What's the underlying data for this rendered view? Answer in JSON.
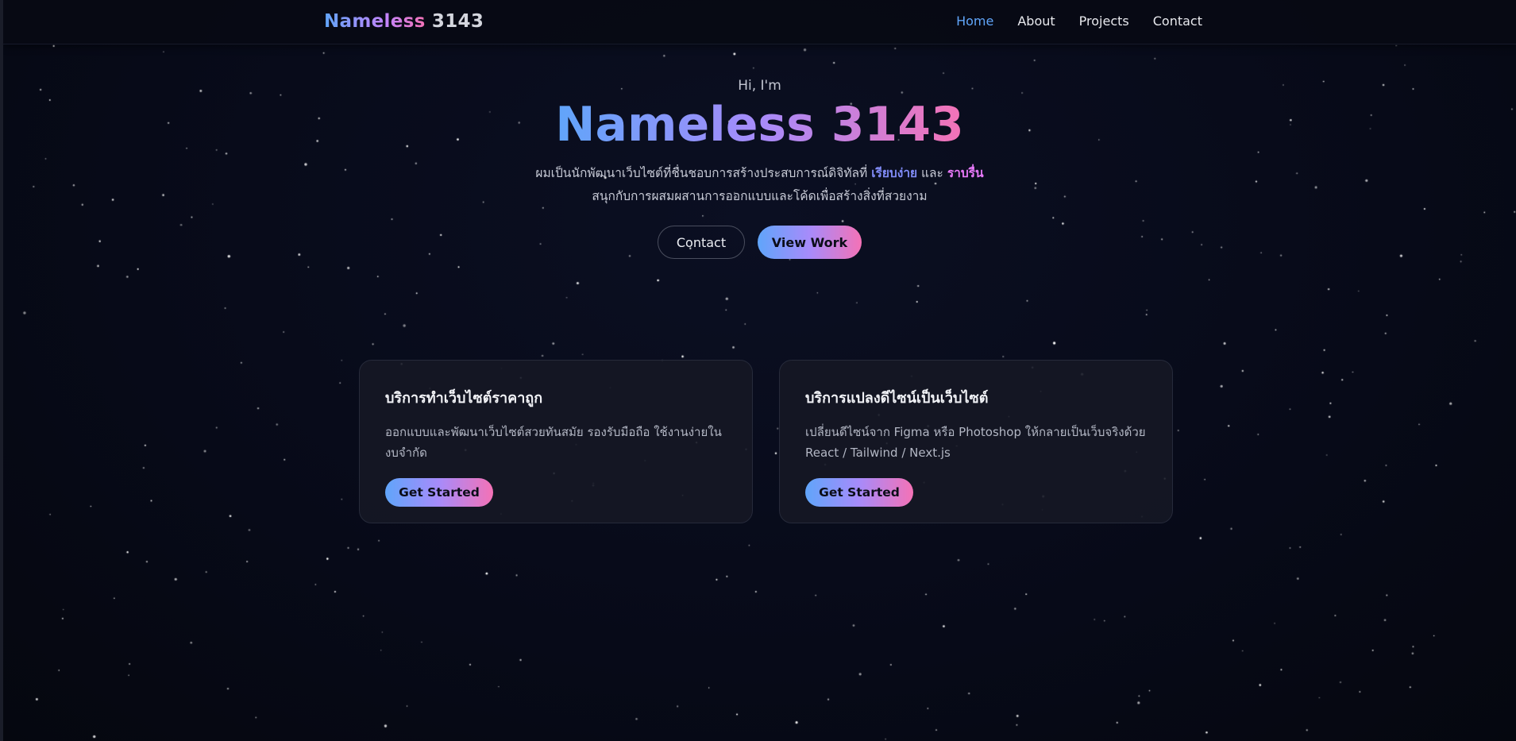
{
  "nav": {
    "brand_name": "Nameless",
    "brand_number": "3143",
    "links": [
      {
        "label": "Home",
        "active": true
      },
      {
        "label": "About",
        "active": false
      },
      {
        "label": "Projects",
        "active": false
      },
      {
        "label": "Contact",
        "active": false
      }
    ]
  },
  "hero": {
    "greeting": "Hi, I'm",
    "title": "Nameless 3143",
    "line1_prefix": "ผมเป็นนักพัฒนาเว็บไซต์ที่ชื่นชอบการสร้างประสบการณ์ดิจิทัลที่",
    "line1_accent1": "เรียบง่าย",
    "line1_middle": "และ",
    "line1_accent2": "ราบรื่น",
    "line2": "สนุกกับการผสมผสานการออกแบบและโค้ดเพื่อสร้างสิ่งที่สวยงาม",
    "contact_button": "Contact",
    "view_work_button": "View Work"
  },
  "services": [
    {
      "title": "บริการทำเว็บไซต์ราคาถูก",
      "description": "ออกแบบและพัฒนาเว็บไซต์สวยทันสมัย รองรับมือถือ ใช้งานง่ายในงบจำกัด",
      "button": "Get Started"
    },
    {
      "title": "บริการแปลงดีไซน์เป็นเว็บไซต์",
      "description": "เปลี่ยนดีไซน์จาก Figma หรือ Photoshop ให้กลายเป็นเว็บจริงด้วย React / Tailwind / Next.js",
      "button": "Get Started"
    }
  ],
  "colors": {
    "background": "#070a18",
    "nav_active": "#60a5fa",
    "gradient_start": "#60a5fa",
    "gradient_mid": "#a78bfa",
    "gradient_end": "#f472b6",
    "card_bg": "#161824"
  }
}
